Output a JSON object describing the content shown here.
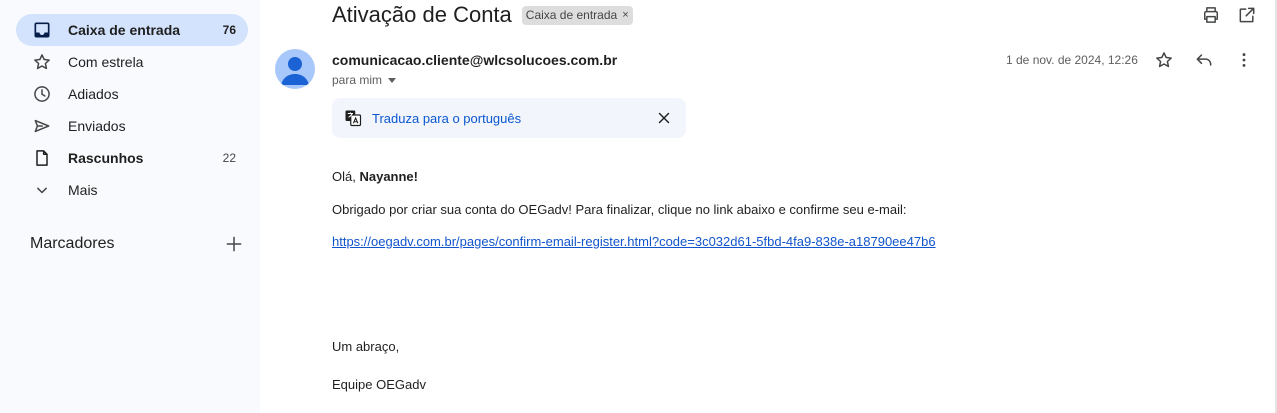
{
  "sidebar": {
    "items": [
      {
        "label": "Caixa de entrada",
        "count": "76",
        "icon": "inbox-icon"
      },
      {
        "label": "Com estrela",
        "count": "",
        "icon": "star-icon"
      },
      {
        "label": "Adiados",
        "count": "",
        "icon": "clock-icon"
      },
      {
        "label": "Enviados",
        "count": "",
        "icon": "send-icon"
      },
      {
        "label": "Rascunhos",
        "count": "22",
        "icon": "draft-icon"
      },
      {
        "label": "Mais",
        "count": "",
        "icon": "chevron-down-icon"
      }
    ],
    "labels_title": "Marcadores",
    "labels_add_icon": "plus-icon"
  },
  "email": {
    "subject": "Ativação de Conta",
    "label_chip": "Caixa de entrada",
    "chip_close": "×",
    "sender": "comunicacao.cliente@wlcsolucoes.com.br",
    "recipient": "para mim",
    "date": "1 de nov. de 2024, 12:26",
    "translate_text": "Traduza para o português",
    "greeting_prefix": "Olá, ",
    "greeting_name": "Nayanne!",
    "paragraph": "Obrigado por criar sua conta do OEGadv! Para finalizar, clique no link abaixo e confirme seu e-mail:",
    "link": "https://oegadv.com.br/pages/confirm-email-register.html?code=3c032d61-5fbd-4fa9-838e-a18790ee47b6",
    "closing": "Um abraço,",
    "signature": "Equipe OEGadv"
  },
  "colors": {
    "sidebar_bg": "#f8fafd",
    "active_bg": "#d3e3fd",
    "link": "#1155cc",
    "avatar": "#a8c7fa"
  }
}
